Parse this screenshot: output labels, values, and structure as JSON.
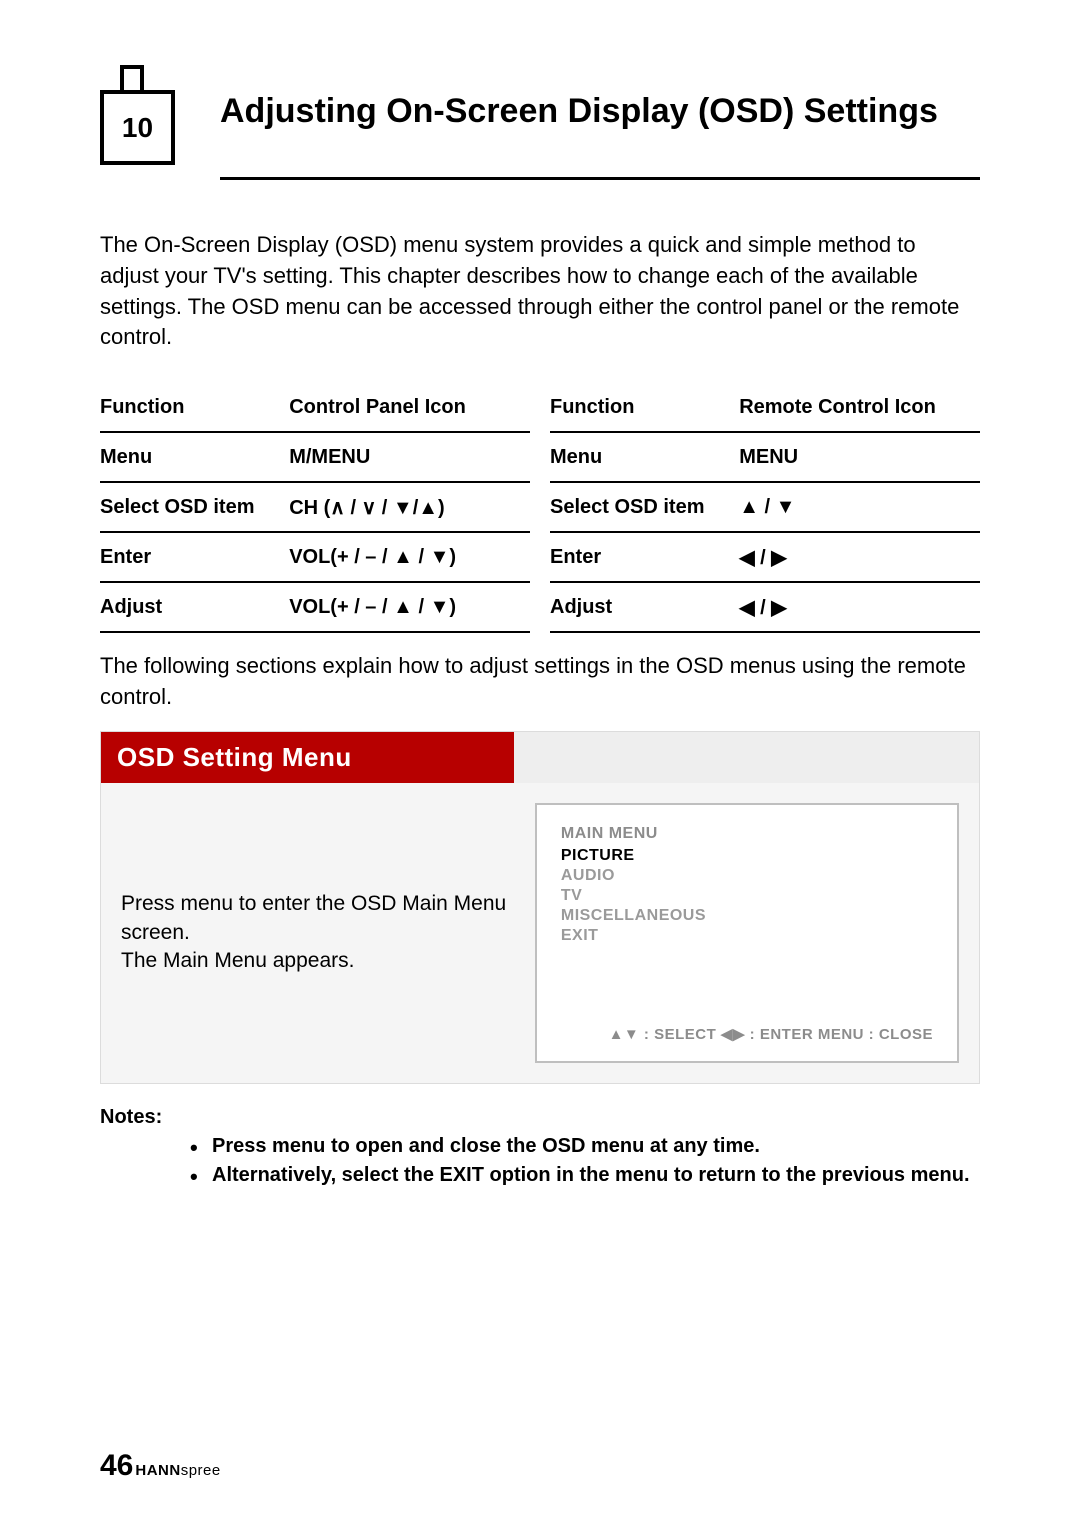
{
  "chapter": {
    "number": "10",
    "title": "Adjusting On-Screen Display (OSD) Settings"
  },
  "intro": "The On-Screen Display (OSD) menu system provides a quick and simple method to adjust your TV's setting. This chapter describes how to change each of the available settings. The OSD menu can be accessed through either the control panel or the remote control.",
  "leftTable": {
    "h1": "Function",
    "h2": "Control Panel Icon",
    "rows": [
      {
        "f": "Menu",
        "i": "M/MENU"
      },
      {
        "f": "Select OSD item",
        "i": "CH (∧ / ∨ / ▼/▲)"
      },
      {
        "f": "Enter",
        "i": "VOL(+ / – / ▲ / ▼)"
      },
      {
        "f": "Adjust",
        "i": "VOL(+ / – / ▲ / ▼)"
      }
    ]
  },
  "rightTable": {
    "h1": "Function",
    "h2": "Remote Control Icon",
    "rows": [
      {
        "f": "Menu",
        "i": "MENU"
      },
      {
        "f": "Select OSD item",
        "i": "▲ / ▼"
      },
      {
        "f": "Enter",
        "i": "◀ / ▶"
      },
      {
        "f": "Adjust",
        "i": "◀ / ▶"
      }
    ]
  },
  "follow": "The following sections explain how to adjust settings in the OSD menus using the remote control.",
  "osdSection": {
    "heading": "OSD Setting Menu",
    "instructionsL1": "Press menu to enter the OSD Main Menu screen.",
    "instructionsL2": "The Main Menu appears.",
    "menuTitle": "MAIN MENU",
    "items": [
      {
        "label": "PICTURE",
        "active": true
      },
      {
        "label": "AUDIO",
        "active": false
      },
      {
        "label": "TV",
        "active": false
      },
      {
        "label": "MISCELLANEOUS",
        "active": false
      },
      {
        "label": "EXIT",
        "active": false
      }
    ],
    "hint": "▲▼ : SELECT  ◀▶ : ENTER   MENU : CLOSE"
  },
  "notes": {
    "heading": "Notes:",
    "items": [
      "Press menu to open and close the OSD menu at any time.",
      "Alternatively, select the EXIT option in the menu to return to the previous menu."
    ]
  },
  "footer": {
    "page": "46",
    "brand1": "HANN",
    "brand2": "spree"
  }
}
